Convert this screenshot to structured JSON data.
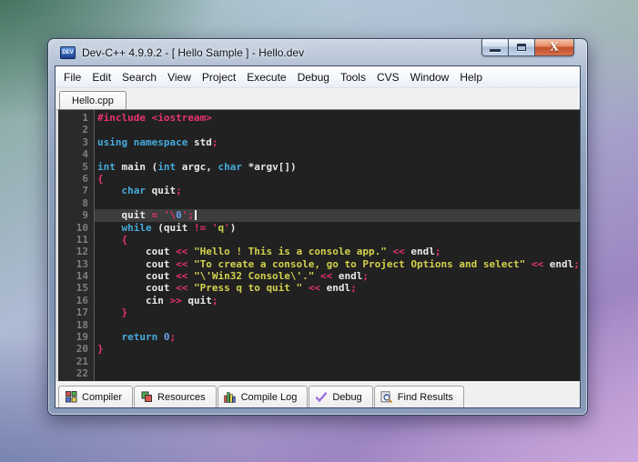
{
  "window": {
    "title": "Dev-C++ 4.9.9.2  -  [ Hello Sample ] - Hello.dev",
    "app_icon_text": "DEV",
    "controls": [
      {
        "name": "minimize",
        "icon": "minimize-icon"
      },
      {
        "name": "maximize",
        "icon": "maximize-icon"
      },
      {
        "name": "close",
        "icon": "close-icon"
      }
    ]
  },
  "menu": {
    "items": [
      "File",
      "Edit",
      "Search",
      "View",
      "Project",
      "Execute",
      "Debug",
      "Tools",
      "CVS",
      "Window",
      "Help"
    ]
  },
  "editor": {
    "tab_label": "Hello.cpp",
    "current_line": 9,
    "colors": {
      "background": "#212121",
      "gutter_background": "#2a2a2a",
      "current_line_background": "#3d3d3d",
      "line_number": "#7f7f7f",
      "keyword": "#46aadc",
      "identifier": "#e8e8e8",
      "operator": "#e8336e",
      "preprocessor": "#e8336e",
      "string": "#d2d24e",
      "number": "#6a9fe8",
      "caret": "#ffffff"
    },
    "lines": [
      [
        {
          "t": "#include <iostream>",
          "c": "pp"
        }
      ],
      [],
      [
        {
          "t": "using",
          "c": "kw"
        },
        {
          "t": " ",
          "c": "id"
        },
        {
          "t": "namespace",
          "c": "kw"
        },
        {
          "t": " std",
          "c": "id"
        },
        {
          "t": ";",
          "c": "op"
        }
      ],
      [],
      [
        {
          "t": "int",
          "c": "kw"
        },
        {
          "t": " main (",
          "c": "id"
        },
        {
          "t": "int",
          "c": "kw"
        },
        {
          "t": " argc, ",
          "c": "id"
        },
        {
          "t": "char",
          "c": "kw"
        },
        {
          "t": " *argv[])",
          "c": "id"
        }
      ],
      [
        {
          "t": "{",
          "c": "op"
        }
      ],
      [
        {
          "t": "    ",
          "c": "id"
        },
        {
          "t": "char",
          "c": "kw"
        },
        {
          "t": " quit",
          "c": "id"
        },
        {
          "t": ";",
          "c": "op"
        }
      ],
      [],
      [
        {
          "t": "    quit ",
          "c": "id"
        },
        {
          "t": "= ",
          "c": "op"
        },
        {
          "t": "'\\",
          "c": "op"
        },
        {
          "t": "0",
          "c": "num"
        },
        {
          "t": "'",
          "c": "op"
        },
        {
          "t": ";",
          "c": "op"
        }
      ],
      [
        {
          "t": "    ",
          "c": "id"
        },
        {
          "t": "while",
          "c": "kw"
        },
        {
          "t": " (quit ",
          "c": "id"
        },
        {
          "t": "!= ",
          "c": "op"
        },
        {
          "t": "'",
          "c": "op"
        },
        {
          "t": "q",
          "c": "str"
        },
        {
          "t": "'",
          "c": "op"
        },
        {
          "t": ")",
          "c": "id"
        }
      ],
      [
        {
          "t": "    ",
          "c": "id"
        },
        {
          "t": "{",
          "c": "op"
        }
      ],
      [
        {
          "t": "        cout ",
          "c": "id"
        },
        {
          "t": "<< ",
          "c": "op"
        },
        {
          "t": "\"Hello ! This is a console app.\"",
          "c": "str"
        },
        {
          "t": " ",
          "c": "id"
        },
        {
          "t": "<<",
          "c": "op"
        },
        {
          "t": " endl",
          "c": "id"
        },
        {
          "t": ";",
          "c": "op"
        }
      ],
      [
        {
          "t": "        cout ",
          "c": "id"
        },
        {
          "t": "<< ",
          "c": "op"
        },
        {
          "t": "\"To create a console, go to Project Options and select\"",
          "c": "str"
        },
        {
          "t": " ",
          "c": "id"
        },
        {
          "t": "<<",
          "c": "op"
        },
        {
          "t": " endl",
          "c": "id"
        },
        {
          "t": ";",
          "c": "op"
        }
      ],
      [
        {
          "t": "        cout ",
          "c": "id"
        },
        {
          "t": "<< ",
          "c": "op"
        },
        {
          "t": "\"\\'Win32 Console\\'.\"",
          "c": "str"
        },
        {
          "t": " ",
          "c": "id"
        },
        {
          "t": "<<",
          "c": "op"
        },
        {
          "t": " endl",
          "c": "id"
        },
        {
          "t": ";",
          "c": "op"
        }
      ],
      [
        {
          "t": "        cout ",
          "c": "id"
        },
        {
          "t": "<< ",
          "c": "op"
        },
        {
          "t": "\"Press q to quit \"",
          "c": "str"
        },
        {
          "t": " ",
          "c": "id"
        },
        {
          "t": "<<",
          "c": "op"
        },
        {
          "t": " endl",
          "c": "id"
        },
        {
          "t": ";",
          "c": "op"
        }
      ],
      [
        {
          "t": "        cin ",
          "c": "id"
        },
        {
          "t": ">> ",
          "c": "op"
        },
        {
          "t": "quit",
          "c": "id"
        },
        {
          "t": ";",
          "c": "op"
        }
      ],
      [
        {
          "t": "    ",
          "c": "id"
        },
        {
          "t": "}",
          "c": "op"
        }
      ],
      [],
      [
        {
          "t": "    ",
          "c": "id"
        },
        {
          "t": "return",
          "c": "kw"
        },
        {
          "t": " ",
          "c": "id"
        },
        {
          "t": "0",
          "c": "num"
        },
        {
          "t": ";",
          "c": "op"
        }
      ],
      [
        {
          "t": "}",
          "c": "op"
        }
      ],
      [],
      []
    ]
  },
  "bottom_tabs": [
    {
      "label": "Compiler",
      "icon": "compiler-grid-icon"
    },
    {
      "label": "Resources",
      "icon": "resources-layers-icon"
    },
    {
      "label": "Compile Log",
      "icon": "bar-chart-icon"
    },
    {
      "label": "Debug",
      "icon": "check-mark-icon"
    },
    {
      "label": "Find Results",
      "icon": "magnifier-icon"
    }
  ]
}
